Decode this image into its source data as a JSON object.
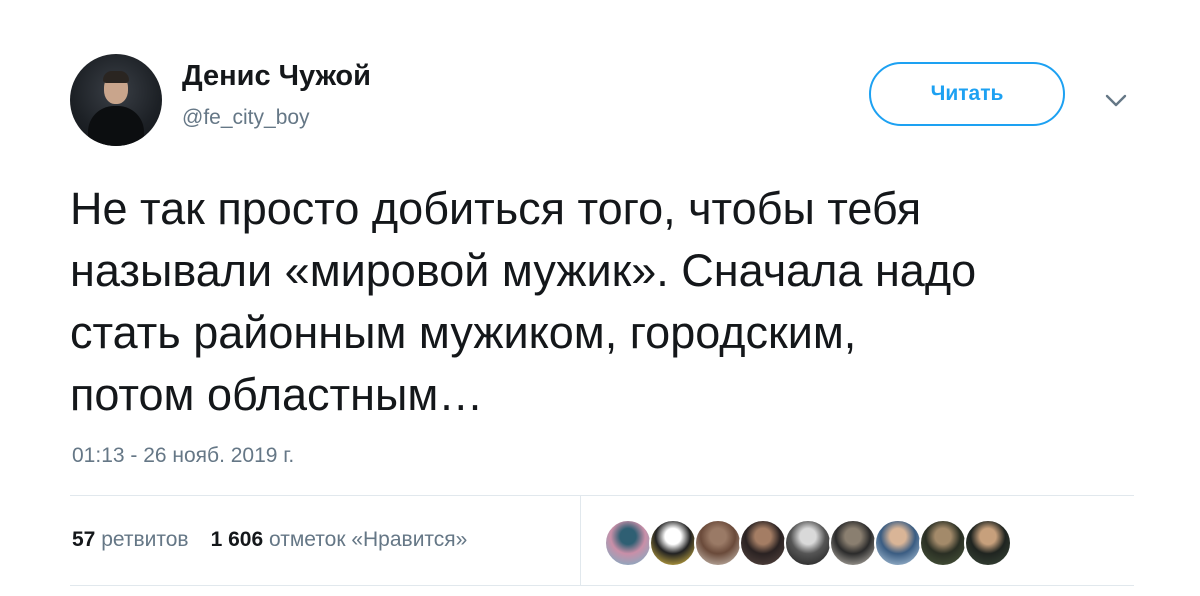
{
  "author": {
    "display_name": "Денис Чужой",
    "handle": "@fe_city_boy"
  },
  "actions": {
    "follow_label": "Читать",
    "more_icon": "chevron-down-icon"
  },
  "tweet": {
    "text_lines": [
      "Не так просто добиться того, чтобы тебя",
      "называли «мировой мужик». Сначала надо",
      "стать районным мужиком, городским,",
      "потом областным…"
    ],
    "timestamp": "01:13 - 26 нояб. 2019 г."
  },
  "stats": {
    "retweets_count": "57",
    "retweets_label": "ретвитов",
    "likes_count": "1 606",
    "likes_label": "отметок «Нравится»"
  },
  "colors": {
    "accent": "#1da1f2",
    "secondary_text": "#657786",
    "primary_text": "#14171a",
    "divider": "#e1e8ed"
  },
  "liker_avatars": [
    {
      "name": "liker-avatar-1",
      "palette": [
        "#6fb3c9",
        "#c98fa8",
        "#2f5f73"
      ]
    },
    {
      "name": "liker-avatar-2",
      "palette": [
        "#f6d24a",
        "#222222",
        "#ffffff"
      ]
    },
    {
      "name": "liker-avatar-3",
      "palette": [
        "#d8cfc4",
        "#6a4a3a",
        "#9a7a66"
      ]
    },
    {
      "name": "liker-avatar-4",
      "palette": [
        "#5b4a44",
        "#2a2222",
        "#a47d64"
      ]
    },
    {
      "name": "liker-avatar-5",
      "palette": [
        "#1c1c1c",
        "#555555",
        "#d9d9d9"
      ]
    },
    {
      "name": "liker-avatar-6",
      "palette": [
        "#cfc9bf",
        "#2b2b2b",
        "#8a7f70"
      ]
    },
    {
      "name": "liker-avatar-7",
      "palette": [
        "#bcd3e6",
        "#3a5c82",
        "#d9b597"
      ]
    },
    {
      "name": "liker-avatar-8",
      "palette": [
        "#4d5b3e",
        "#2a2f24",
        "#a38a6a"
      ]
    },
    {
      "name": "liker-avatar-9",
      "palette": [
        "#3c4a3a",
        "#1f2420",
        "#c7a07c"
      ]
    }
  ]
}
